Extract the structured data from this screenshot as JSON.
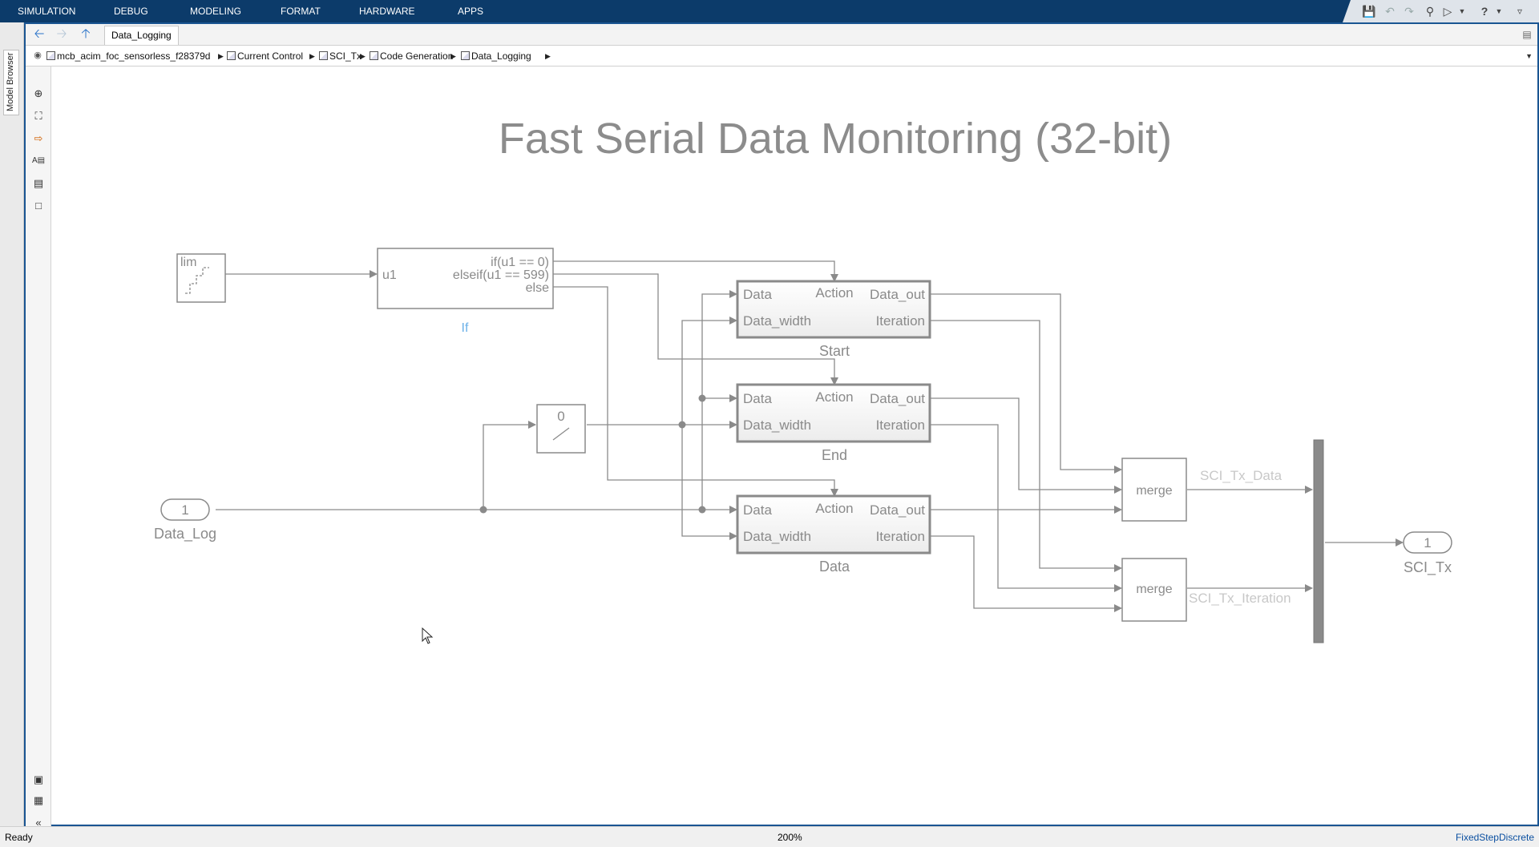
{
  "menu": {
    "tabs": [
      "SIMULATION",
      "DEBUG",
      "MODELING",
      "FORMAT",
      "HARDWARE",
      "APPS"
    ]
  },
  "side_panel": {
    "model_browser_label": "Model Browser"
  },
  "editor": {
    "tab_label": "Data_Logging",
    "breadcrumb": [
      "mcb_acim_foc_sensorless_f28379d",
      "Current Control",
      "SCI_Tx",
      "Code Generation",
      "Data_Logging"
    ]
  },
  "diagram": {
    "title": "Fast Serial Data Monitoring (32-bit)",
    "lim_block": {
      "label": "lim"
    },
    "if_block": {
      "name": "If",
      "input": "u1",
      "outputs": [
        "if(u1 == 0)",
        "elseif(u1 == 599)",
        "else"
      ]
    },
    "subsystems": [
      {
        "name": "Start",
        "in1": "Data",
        "in2": "Data_width",
        "action": "Action",
        "out1": "Data_out",
        "out2": "Iteration"
      },
      {
        "name": "End",
        "in1": "Data",
        "in2": "Data_width",
        "action": "Action",
        "out1": "Data_out",
        "out2": "Iteration"
      },
      {
        "name": "Data",
        "in1": "Data",
        "in2": "Data_width",
        "action": "Action",
        "out1": "Data_out",
        "out2": "Iteration"
      }
    ],
    "width_block": {
      "value": "0"
    },
    "inport": {
      "number": "1",
      "name": "Data_Log"
    },
    "merge_blocks": [
      {
        "label": "merge"
      },
      {
        "label": "merge"
      }
    ],
    "signals": {
      "merge1_out": "SCI_Tx_Data",
      "merge2_out": "SCI_Tx_Iteration"
    },
    "outport": {
      "number": "1",
      "name": "SCI_Tx"
    }
  },
  "status": {
    "left": "Ready",
    "zoom": "200%",
    "solver": "FixedStepDiscrete"
  },
  "colors": {
    "toolstrip": "#0c3b6a",
    "frame_border": "#1a5592",
    "block_stroke": "#8a8a8a",
    "if_label": "#6ab0e8",
    "signal_label": "#c8c8c8"
  }
}
